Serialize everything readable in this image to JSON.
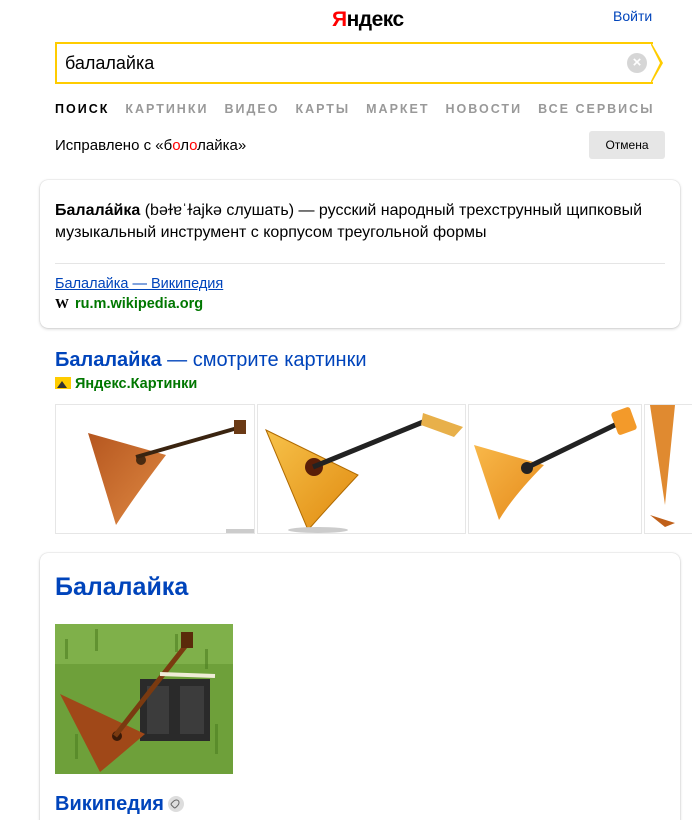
{
  "header": {
    "logo_first": "Я",
    "logo_rest": "ндекс",
    "login_label": "Войти"
  },
  "search": {
    "query": "балалайка",
    "clear_glyph": "×"
  },
  "tabs": [
    {
      "label": "поиск",
      "active": true
    },
    {
      "label": "картинки"
    },
    {
      "label": "видео"
    },
    {
      "label": "карты"
    },
    {
      "label": "маркет"
    },
    {
      "label": "новости"
    },
    {
      "label": "все сервисы"
    }
  ],
  "correction": {
    "prefix": "Исправлено с «б",
    "hl1": "о",
    "mid1": "л",
    "hl2": "о",
    "suffix": "лайка»",
    "cancel_label": "Отмена"
  },
  "fact_card": {
    "term": "Балала́йка",
    "definition": " (bəɫɐˈɫajkə слушать) — русский народный трехструнный щипковый музыкальный инструмент с корпусом треугольной формы",
    "source_title": "Балалайка — Википедия",
    "source_icon": "W",
    "source_url": "ru.m.wikipedia.org"
  },
  "images_block": {
    "title_bold": "Балалайка",
    "title_rest": " — смотрите картинки",
    "source": "Яндекс.Картинки",
    "thumbs_count_label": ""
  },
  "wiki_card": {
    "heading": "Балалайка",
    "link_label": "Википедия"
  },
  "colors": {
    "link": "#0044bb",
    "url_green": "#007700",
    "accent_yellow": "#ffcc00",
    "brand_red": "#ff0000"
  }
}
